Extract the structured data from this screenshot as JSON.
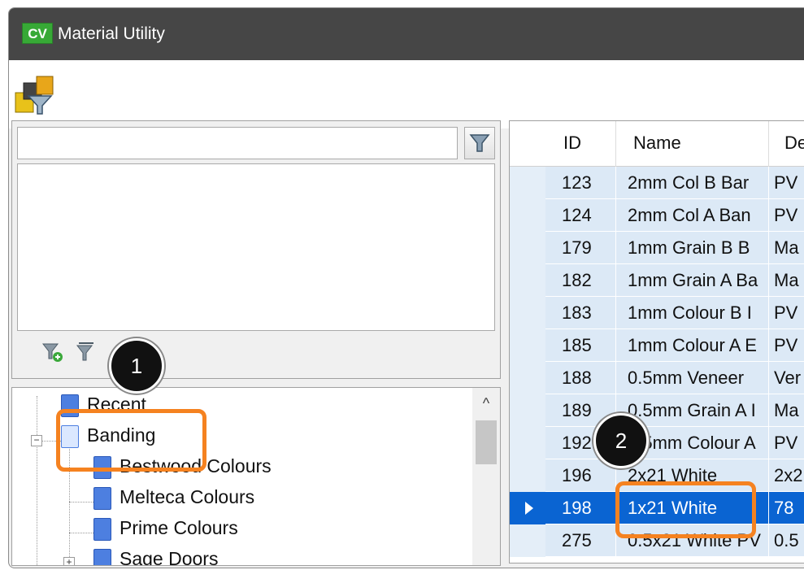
{
  "window": {
    "title": "Material Utility",
    "app_icon_text": "CV"
  },
  "filter": {
    "search_value": ""
  },
  "tree": {
    "items": [
      {
        "label": "Recent"
      },
      {
        "label": "Banding"
      },
      {
        "label": "Bestwood Colours"
      },
      {
        "label": "Melteca Colours"
      },
      {
        "label": "Prime Colours"
      },
      {
        "label": "Sage Doors"
      }
    ],
    "scroll_up": "^"
  },
  "grid": {
    "columns": [
      "ID",
      "Name",
      "De"
    ],
    "rows": [
      {
        "id": "123",
        "name": "2mm Col B Bar",
        "desc": "PV"
      },
      {
        "id": "124",
        "name": "2mm Col A Ban",
        "desc": "PV"
      },
      {
        "id": "179",
        "name": "1mm Grain B B",
        "desc": "Ma"
      },
      {
        "id": "182",
        "name": "1mm Grain A Ba",
        "desc": "Ma"
      },
      {
        "id": "183",
        "name": "1mm Colour B I",
        "desc": "PV"
      },
      {
        "id": "185",
        "name": "1mm Colour A E",
        "desc": "PV"
      },
      {
        "id": "188",
        "name": "0.5mm Veneer",
        "desc": "Ver"
      },
      {
        "id": "189",
        "name": "0.5mm Grain A I",
        "desc": "Ma"
      },
      {
        "id": "192",
        "name": "0.5mm Colour A",
        "desc": "PV"
      },
      {
        "id": "196",
        "name": "2x21 White",
        "desc": "2x2"
      },
      {
        "id": "198",
        "name": "1x21 White",
        "desc": "78"
      },
      {
        "id": "275",
        "name": "0.5x21 White PV",
        "desc": "0.5"
      }
    ],
    "selected_id": "198"
  },
  "callouts": [
    "1",
    "2"
  ],
  "colors": {
    "highlight": "#f58220",
    "selection": "#0a64d2",
    "titlebar": "#464646"
  }
}
